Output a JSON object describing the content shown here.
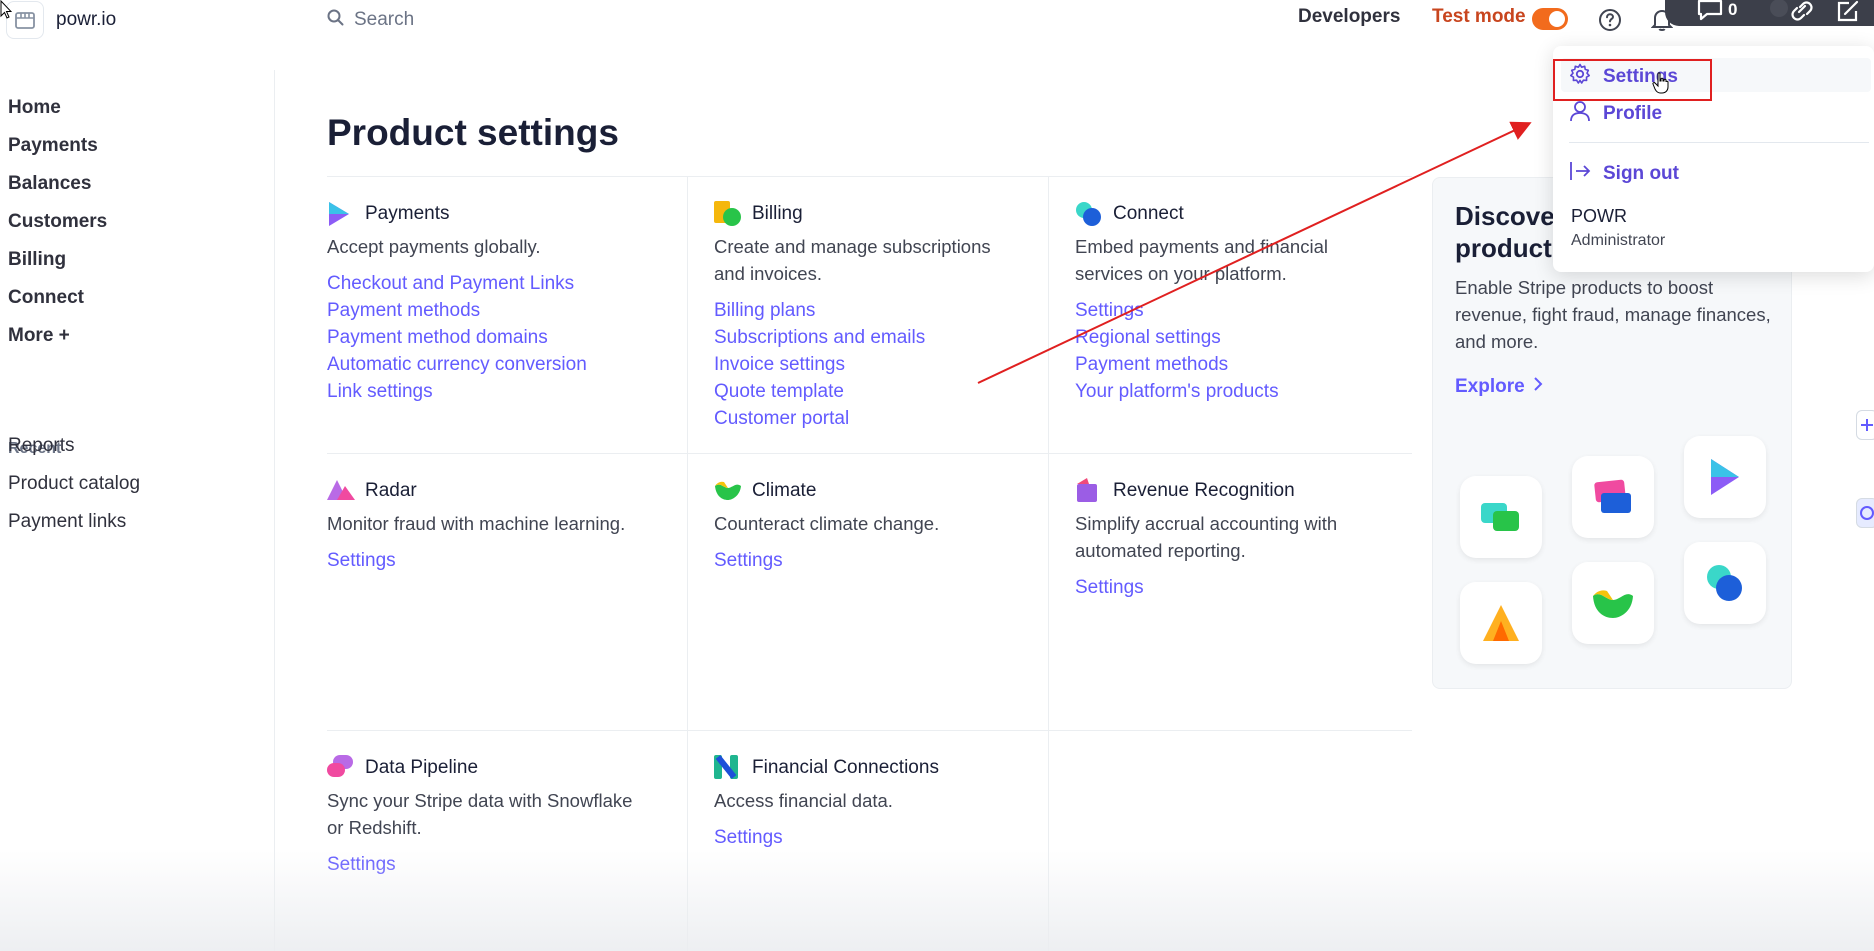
{
  "brand": {
    "name": "powr.io"
  },
  "search": {
    "placeholder": "Search"
  },
  "header": {
    "developers": "Developers",
    "test_mode": "Test mode",
    "chat_count": "0"
  },
  "sidebar": {
    "items": [
      "Home",
      "Payments",
      "Balances",
      "Customers",
      "Billing",
      "Connect",
      "More +"
    ],
    "recent_title": "Recent",
    "recent": [
      "Reports",
      "Product catalog",
      "Payment links"
    ]
  },
  "main": {
    "title": "Product settings",
    "cards": [
      {
        "title": "Payments",
        "desc": "Accept payments globally.",
        "links": [
          "Checkout and Payment Links",
          "Payment methods",
          "Payment method domains",
          "Automatic currency conversion",
          "Link settings"
        ]
      },
      {
        "title": "Billing",
        "desc": "Create and manage subscriptions and invoices.",
        "links": [
          "Billing plans",
          "Subscriptions and emails",
          "Invoice settings",
          "Quote template",
          "Customer portal"
        ]
      },
      {
        "title": "Connect",
        "desc": "Embed payments and financial services on your platform.",
        "links": [
          "Settings",
          "Regional settings",
          "Payment methods",
          "Your platform's products"
        ]
      },
      {
        "title": "Radar",
        "desc": "Monitor fraud with machine learning.",
        "links": [
          "Settings"
        ]
      },
      {
        "title": "Climate",
        "desc": "Counteract climate change.",
        "links": [
          "Settings"
        ]
      },
      {
        "title": "Revenue Recognition",
        "desc": "Simplify accrual accounting with automated reporting.",
        "links": [
          "Settings"
        ]
      },
      {
        "title": "Data Pipeline",
        "desc": "Sync your Stripe data with Snowflake or Redshift.",
        "links": [
          "Settings"
        ]
      },
      {
        "title": "Financial Connections",
        "desc": "Access financial data.",
        "links": [
          "Settings"
        ]
      }
    ]
  },
  "discover": {
    "title_line1": "Discove",
    "title_line2": "product",
    "desc": "Enable Stripe products to boost revenue, fight fraud, manage finances, and more.",
    "explore": "Explore"
  },
  "menu": {
    "settings": "Settings",
    "profile": "Profile",
    "sign_out": "Sign out",
    "org": "POWR",
    "role": "Administrator"
  },
  "colors": {
    "accent": "#635bff",
    "test_mode": "#c8451e",
    "toggle": "#f26b1d",
    "annotation": "#e02020"
  }
}
